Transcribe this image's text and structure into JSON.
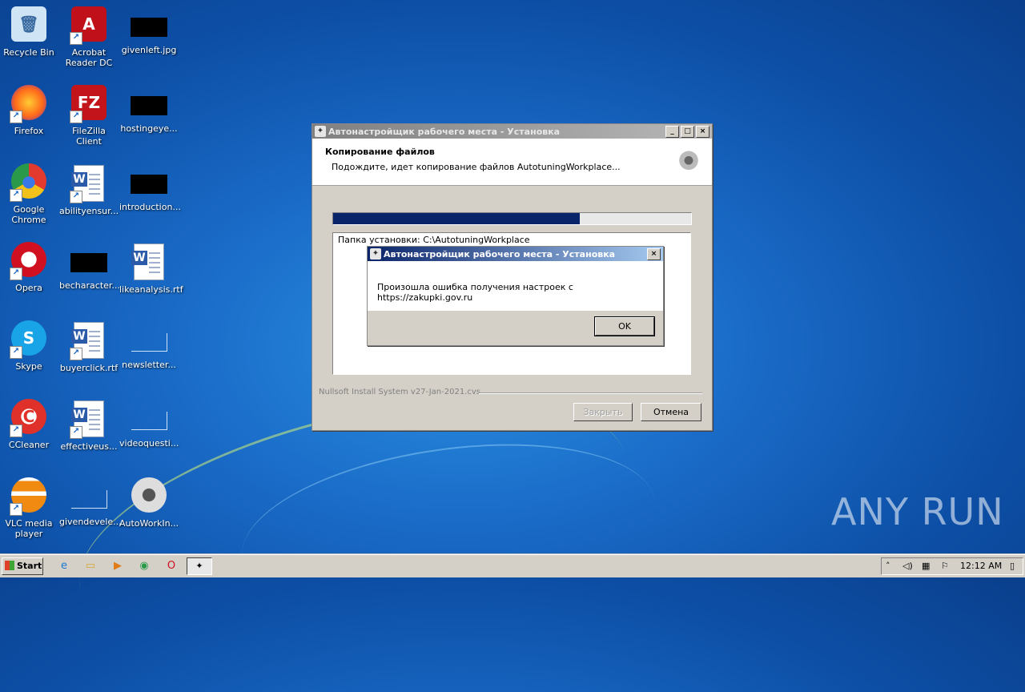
{
  "desktop_icons": [
    {
      "label": "Recycle Bin",
      "kind": "recycle",
      "icon": "recycle-bin-icon"
    },
    {
      "label": "Acrobat\nReader DC",
      "kind": "acrobat",
      "icon": "acrobat-reader-icon"
    },
    {
      "label": "givenleft.jpg",
      "kind": "black",
      "icon": "image-file-icon"
    },
    {
      "label": "Firefox",
      "kind": "firefox",
      "icon": "firefox-icon"
    },
    {
      "label": "FileZilla Client",
      "kind": "filezilla",
      "icon": "filezilla-icon"
    },
    {
      "label": "hostingeye...",
      "kind": "black",
      "icon": "image-file-icon"
    },
    {
      "label": "Google\nChrome",
      "kind": "chrome",
      "icon": "chrome-icon"
    },
    {
      "label": "abilityensur...",
      "kind": "word",
      "icon": "word-doc-icon"
    },
    {
      "label": "introduction...",
      "kind": "black",
      "icon": "image-file-icon"
    },
    {
      "label": "Opera",
      "kind": "opera",
      "icon": "opera-icon"
    },
    {
      "label": "becharacter...",
      "kind": "black",
      "icon": "image-file-icon"
    },
    {
      "label": "likeanalysis.rtf",
      "kind": "word",
      "icon": "word-doc-icon"
    },
    {
      "label": "Skype",
      "kind": "skype",
      "icon": "skype-icon"
    },
    {
      "label": "buyerclick.rtf",
      "kind": "word",
      "icon": "word-doc-icon"
    },
    {
      "label": "newsletter...",
      "kind": "blank",
      "icon": "file-icon"
    },
    {
      "label": "CCleaner",
      "kind": "ccleaner",
      "icon": "ccleaner-icon"
    },
    {
      "label": "effectiveus...",
      "kind": "word",
      "icon": "word-doc-icon"
    },
    {
      "label": "videoquesti...",
      "kind": "blank",
      "icon": "file-icon"
    },
    {
      "label": "VLC media\nplayer",
      "kind": "vlc",
      "icon": "vlc-icon"
    },
    {
      "label": "givendevele...",
      "kind": "blank",
      "icon": "file-icon"
    },
    {
      "label": "AutoWorkIn...",
      "kind": "emblem",
      "icon": "installer-emblem-icon"
    }
  ],
  "installer": {
    "title": "Автонастройщик рабочего места - Установка",
    "header_title": "Копирование файлов",
    "header_subtitle": "Подождите, идет копирование файлов AutotuningWorkplace...",
    "progress": 0.69,
    "log_line": "Папка установки: C:\\AutotuningWorkplace",
    "branding": "Nullsoft Install System v27-Jan-2021.cvs",
    "close_label": "Закрыть",
    "cancel_label": "Отмена",
    "min_label": "_",
    "max_label": "□",
    "x_label": "×"
  },
  "message_box": {
    "title": "Автонастройщик рабочего места - Установка",
    "text": "Произошла ошибка получения настроек с https://zakupki.gov.ru",
    "ok_label": "OK",
    "x_label": "×"
  },
  "taskbar": {
    "start_label": "Start",
    "clock": "12:12 AM",
    "quick_launch": [
      "ie-icon",
      "explorer-icon",
      "media-player-icon",
      "chrome-icon",
      "opera-icon"
    ]
  },
  "watermark": "ANY RUN",
  "colors": {
    "accent": "#0a246a",
    "desktop": "#1a6cc8"
  }
}
